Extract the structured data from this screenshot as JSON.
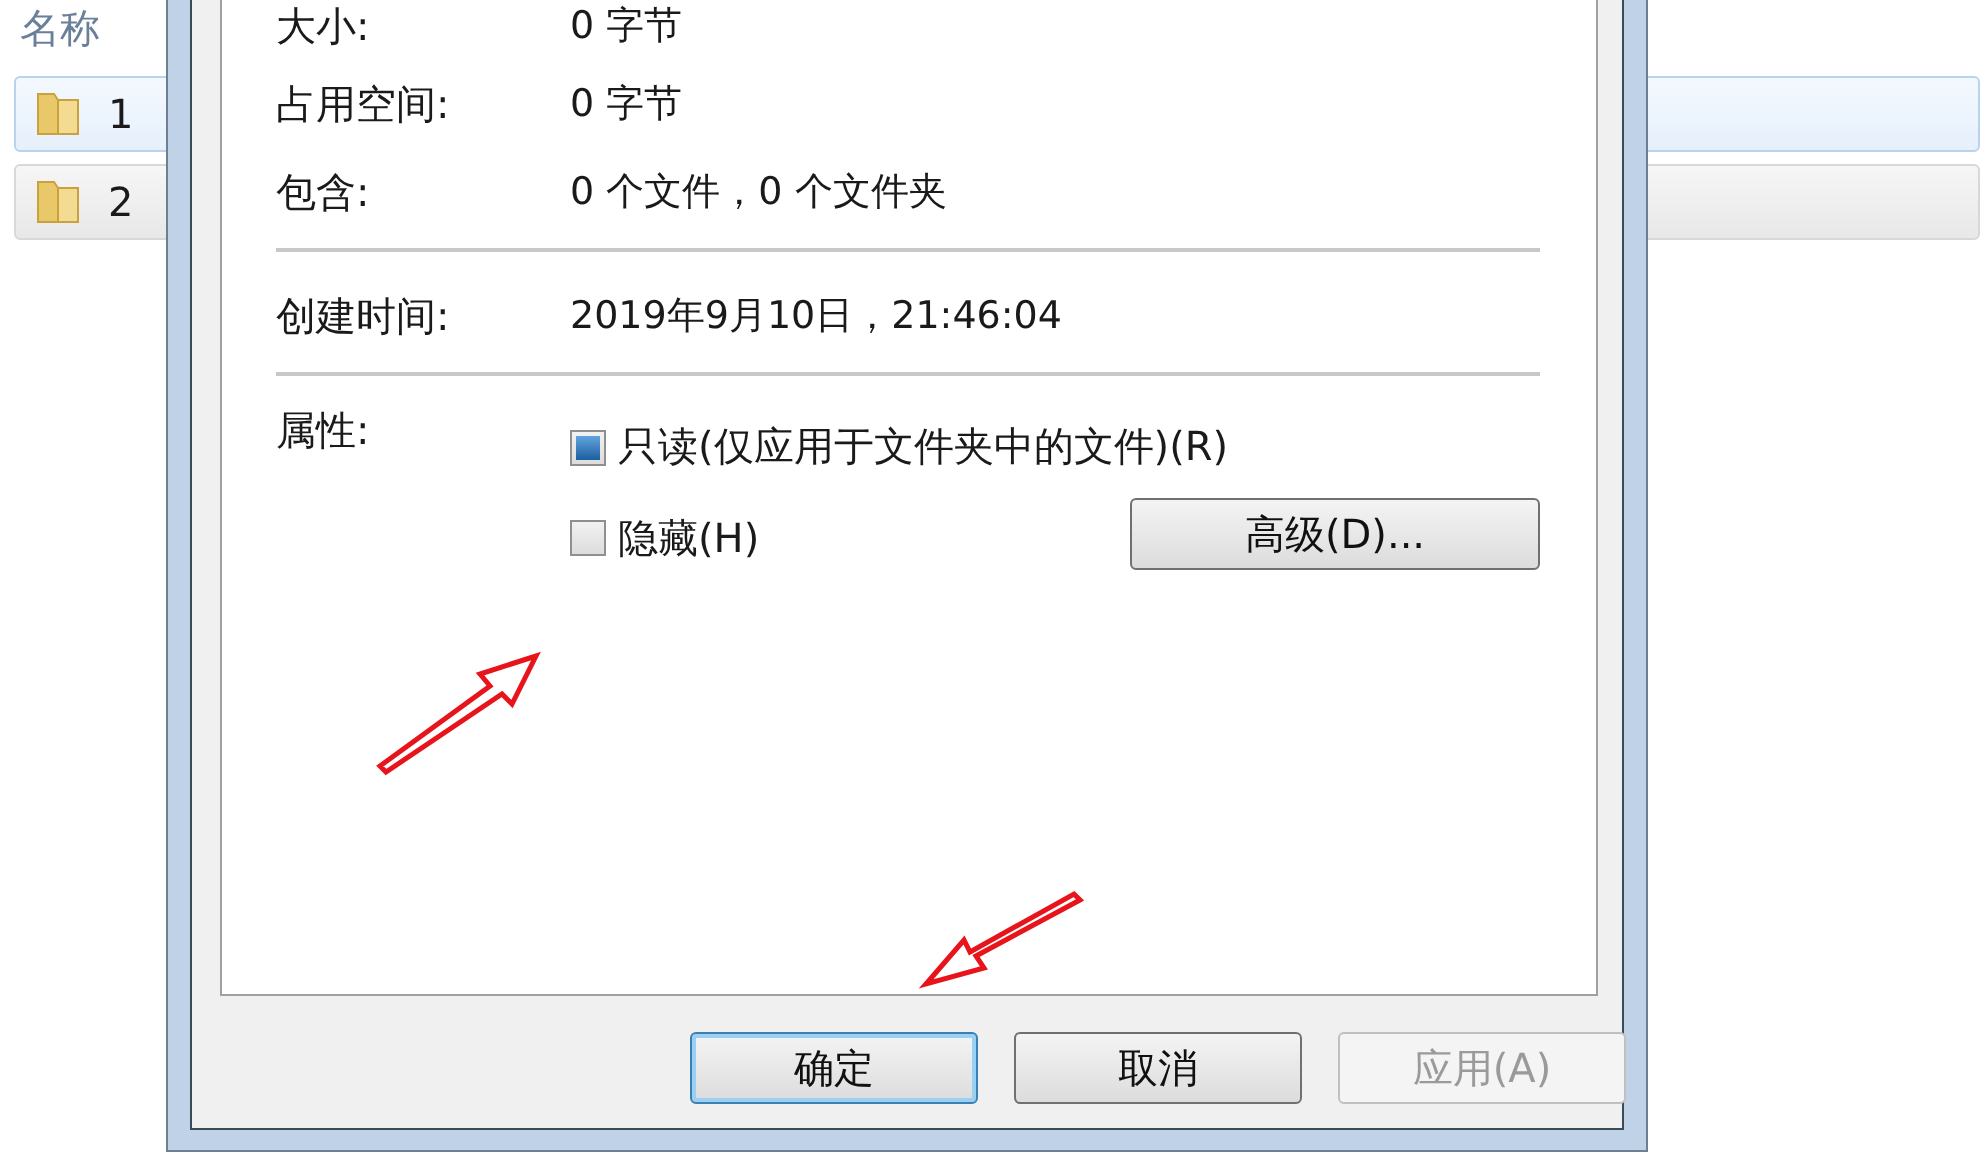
{
  "explorer": {
    "column_header": "名称",
    "items": [
      {
        "name": "1",
        "selected": true
      },
      {
        "name": "2",
        "selected": false
      }
    ]
  },
  "dialog": {
    "rows": [
      {
        "label": "大小:",
        "value": "0 字节"
      },
      {
        "label": "占用空间:",
        "value": "0 字节"
      },
      {
        "label": "包含:",
        "value": "0 个文件，0 个文件夹"
      },
      {
        "label": "创建时间:",
        "value": "2019年9月10日，21:46:04",
        "separator_before": true
      }
    ],
    "attributes": {
      "label": "属性:",
      "options": [
        {
          "label": "只读(仅应用于文件夹中的文件)(R)",
          "checked": false,
          "indeterminate": true
        },
        {
          "label": "隐藏(H)",
          "checked": false,
          "indeterminate": false
        }
      ],
      "advanced_button": "高级(D)..."
    },
    "buttons": [
      {
        "label": "确定",
        "default": true,
        "disabled": false
      },
      {
        "label": "取消",
        "default": false,
        "disabled": false
      },
      {
        "label": "应用(A)",
        "default": false,
        "disabled": true
      }
    ]
  },
  "annotations": [
    {
      "kind": "arrow"
    },
    {
      "kind": "arrow"
    }
  ]
}
